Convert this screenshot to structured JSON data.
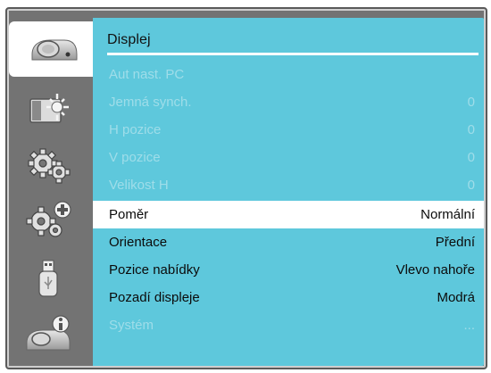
{
  "menu": {
    "title": "Displej",
    "sidebar_tabs": [
      {
        "icon": "projector-icon",
        "active": true
      },
      {
        "icon": "picture-adjust-icon",
        "active": false
      },
      {
        "icon": "settings-gears-icon",
        "active": false
      },
      {
        "icon": "settings-plus-icon",
        "active": false
      },
      {
        "icon": "usb-icon",
        "active": false
      },
      {
        "icon": "projector-info-icon",
        "active": false
      }
    ],
    "items": [
      {
        "label": "Aut nast. PC",
        "value": "",
        "state": "disabled"
      },
      {
        "label": "Jemná synch.",
        "value": "0",
        "state": "disabled"
      },
      {
        "label": "H pozice",
        "value": "0",
        "state": "disabled"
      },
      {
        "label": "V pozice",
        "value": "0",
        "state": "disabled"
      },
      {
        "label": "Velikost H",
        "value": "0",
        "state": "disabled"
      },
      {
        "label": "Poměr",
        "value": "Normální",
        "state": "selected"
      },
      {
        "label": "Orientace",
        "value": "Přední",
        "state": "enabled"
      },
      {
        "label": "Pozice nabídky",
        "value": "Vlevo nahoře",
        "state": "enabled"
      },
      {
        "label": "Pozadí displeje",
        "value": "Modrá",
        "state": "enabled"
      },
      {
        "label": "Systém",
        "value": "...",
        "state": "disabled"
      }
    ]
  },
  "colors": {
    "panel": "#5ec8dc",
    "frame": "#737373",
    "disabled_text": "#9fdde9",
    "selected_row": "#ffffff"
  }
}
